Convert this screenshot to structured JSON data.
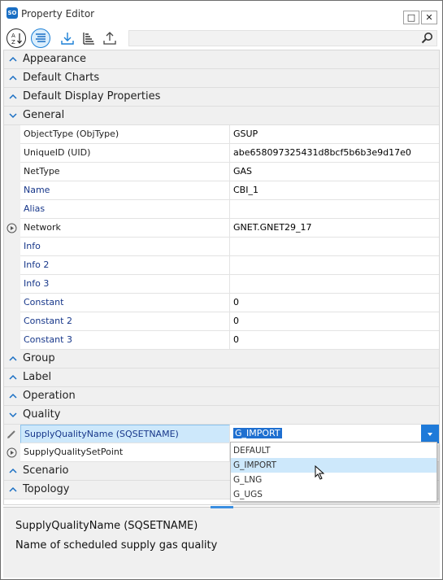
{
  "window": {
    "title": "Property Editor",
    "app_icon": "SO",
    "maximize_label": "□",
    "close_label": "✕"
  },
  "toolbar": {
    "buttons": [
      {
        "icon": "sort-alphabetical-icon"
      },
      {
        "icon": "categorized-view-icon",
        "active": true
      },
      {
        "icon": "import-icon"
      },
      {
        "icon": "sort-list-icon"
      },
      {
        "icon": "export-icon"
      }
    ],
    "search": {
      "value": "",
      "icon": "search-icon"
    }
  },
  "categories": {
    "appearance": "Appearance",
    "default_charts": "Default Charts",
    "default_display": "Default Display Properties",
    "general": "General",
    "group": "Group",
    "label": "Label",
    "operation": "Operation",
    "quality": "Quality",
    "scenario": "Scenario",
    "topology": "Topology"
  },
  "general_rows": [
    {
      "name": "ObjectType (ObjType)",
      "value": "GSUP"
    },
    {
      "name": "UniqueID (UID)",
      "value": "abe658097325431d8bcf5b6b3e9d17e0"
    },
    {
      "name": "NetType",
      "value": "GAS"
    },
    {
      "name": "Name",
      "value": "CBI_1"
    },
    {
      "name": "Alias",
      "value": ""
    },
    {
      "name": "Network",
      "value": "GNET.GNET29_17"
    },
    {
      "name": "Info",
      "value": ""
    },
    {
      "name": "Info 2",
      "value": ""
    },
    {
      "name": "Info 3",
      "value": ""
    },
    {
      "name": "Constant",
      "value": "0"
    },
    {
      "name": "Constant 2",
      "value": "0"
    },
    {
      "name": "Constant 3",
      "value": "0"
    }
  ],
  "quality_rows": [
    {
      "name": "SupplyQualityName (SQSETNAME)",
      "value": "G_IMPORT"
    },
    {
      "name": "SupplyQualitySetPoint",
      "value": ""
    }
  ],
  "dropdown": {
    "options": [
      "DEFAULT",
      "G_IMPORT",
      "G_LNG",
      "G_UGS"
    ],
    "hovered": "G_IMPORT"
  },
  "description": {
    "title": "SupplyQualityName (SQSETNAME)",
    "text": "Name of scheduled supply gas quality"
  }
}
